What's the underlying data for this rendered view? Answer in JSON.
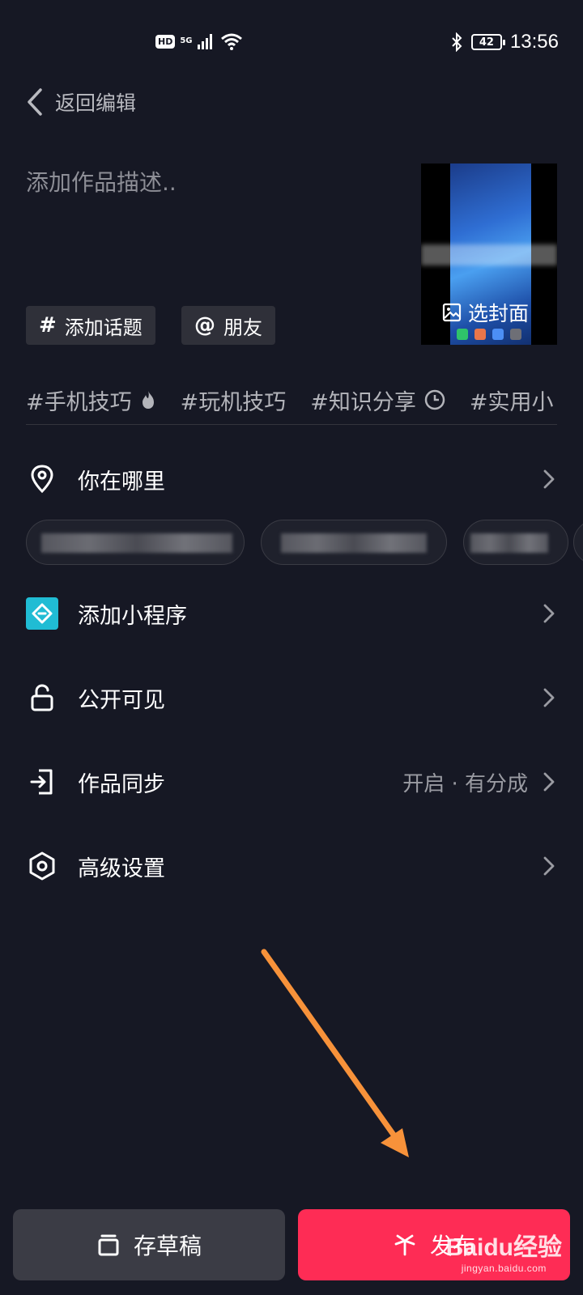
{
  "status_bar": {
    "hd": "HD",
    "network": "5G",
    "battery": "42",
    "time": "13:56"
  },
  "header": {
    "back_label": "返回编辑"
  },
  "description": {
    "placeholder": "添加作品描述.."
  },
  "cover": {
    "label": "选封面"
  },
  "chips": {
    "topic": "添加话题",
    "friends": "朋友"
  },
  "hashtags": [
    "#手机技巧",
    "#玩机技巧",
    "#知识分享",
    "#实用小"
  ],
  "rows": {
    "location": {
      "label": "你在哪里"
    },
    "mini_program": {
      "label": "添加小程序"
    },
    "visibility": {
      "label": "公开可见"
    },
    "sync": {
      "label": "作品同步",
      "value": "开启 · 有分成"
    },
    "advanced": {
      "label": "高级设置"
    }
  },
  "buttons": {
    "draft": "存草稿",
    "publish": "发布"
  },
  "watermark": {
    "main": "Baidu经验",
    "sub": "jingyan.baidu.com"
  },
  "colors": {
    "background": "#161824",
    "publish": "#fe2c55",
    "draft": "#3b3c45",
    "annotation_arrow": "#f7923a"
  }
}
